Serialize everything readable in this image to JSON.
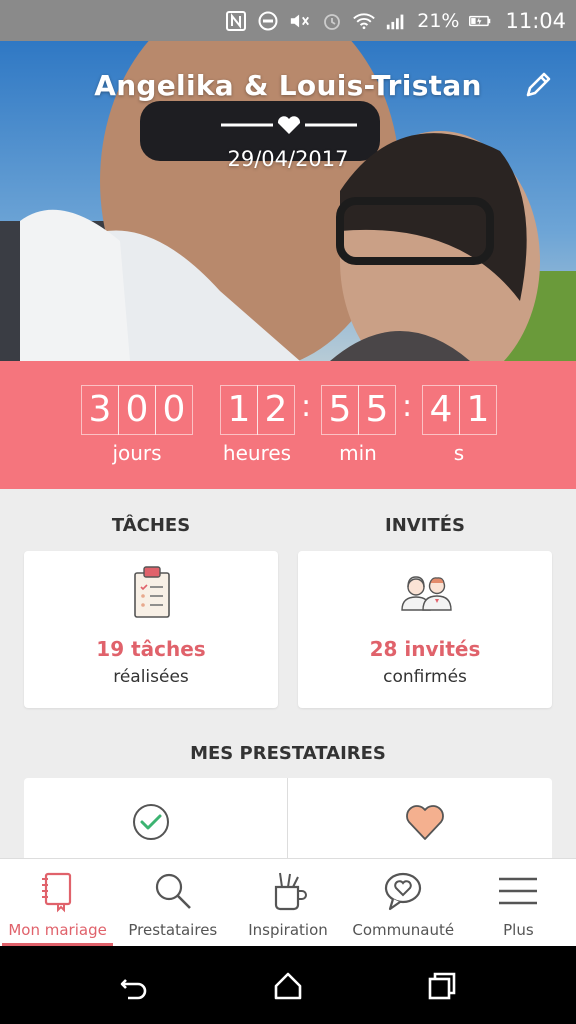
{
  "status_bar": {
    "battery_percent": "21%",
    "time": "11:04",
    "icons": [
      "nfc-icon",
      "do-not-disturb-icon",
      "mute-icon",
      "alarm-icon",
      "wifi-icon",
      "signal-icon",
      "battery-icon"
    ]
  },
  "hero": {
    "couple_names": "Angelika & Louis-Tristan",
    "wedding_date": "29/04/2017"
  },
  "countdown": {
    "days": [
      "3",
      "0",
      "0"
    ],
    "hours": [
      "1",
      "2"
    ],
    "minutes": [
      "5",
      "5"
    ],
    "seconds": [
      "4",
      "1"
    ],
    "label_days": "jours",
    "label_hours": "heures",
    "label_minutes": "min",
    "label_seconds": "s",
    "background_color": "#f5757d"
  },
  "tasks": {
    "heading": "TÂCHES",
    "count_text": "19 tâches",
    "sub_text": "réalisées"
  },
  "guests": {
    "heading": "INVITÉS",
    "count_text": "28 invités",
    "sub_text": "confirmés"
  },
  "vendors": {
    "heading": "MES PRESTATAIRES"
  },
  "bottom_nav": {
    "items": [
      {
        "label": "Mon mariage",
        "icon": "notebook-icon",
        "active": true
      },
      {
        "label": "Prestataires",
        "icon": "search-icon",
        "active": false
      },
      {
        "label": "Inspiration",
        "icon": "brush-cup-icon",
        "active": false
      },
      {
        "label": "Communauté",
        "icon": "chat-heart-icon",
        "active": false
      },
      {
        "label": "Plus",
        "icon": "menu-icon",
        "active": false
      }
    ]
  },
  "colors": {
    "accent": "#e0626b",
    "countdown_bg": "#f5757d"
  }
}
